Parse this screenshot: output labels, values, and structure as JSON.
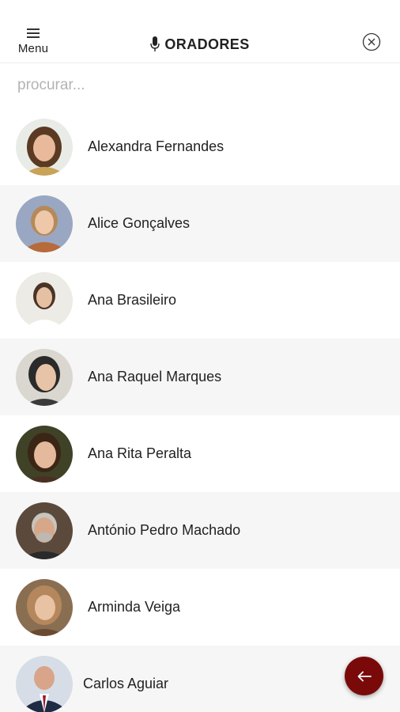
{
  "header": {
    "menu_label": "Menu",
    "title": "ORADORES",
    "icons": {
      "menu": "hamburger-icon",
      "title": "microphone-icon",
      "close": "close-circle-icon"
    }
  },
  "search": {
    "placeholder": "procurar...",
    "value": ""
  },
  "speakers": [
    {
      "name": "Alexandra Fernandes"
    },
    {
      "name": "Alice Gonçalves"
    },
    {
      "name": "Ana Brasileiro"
    },
    {
      "name": "Ana Raquel Marques"
    },
    {
      "name": "Ana Rita Peralta"
    },
    {
      "name": "António Pedro Machado"
    },
    {
      "name": "Arminda Veiga"
    },
    {
      "name": "Carlos Aguiar"
    }
  ],
  "fab": {
    "icon": "arrow-left-icon"
  },
  "colors": {
    "accent": "#7a0a0a",
    "row_alt": "#f6f6f6",
    "placeholder": "#b3b3b3"
  }
}
